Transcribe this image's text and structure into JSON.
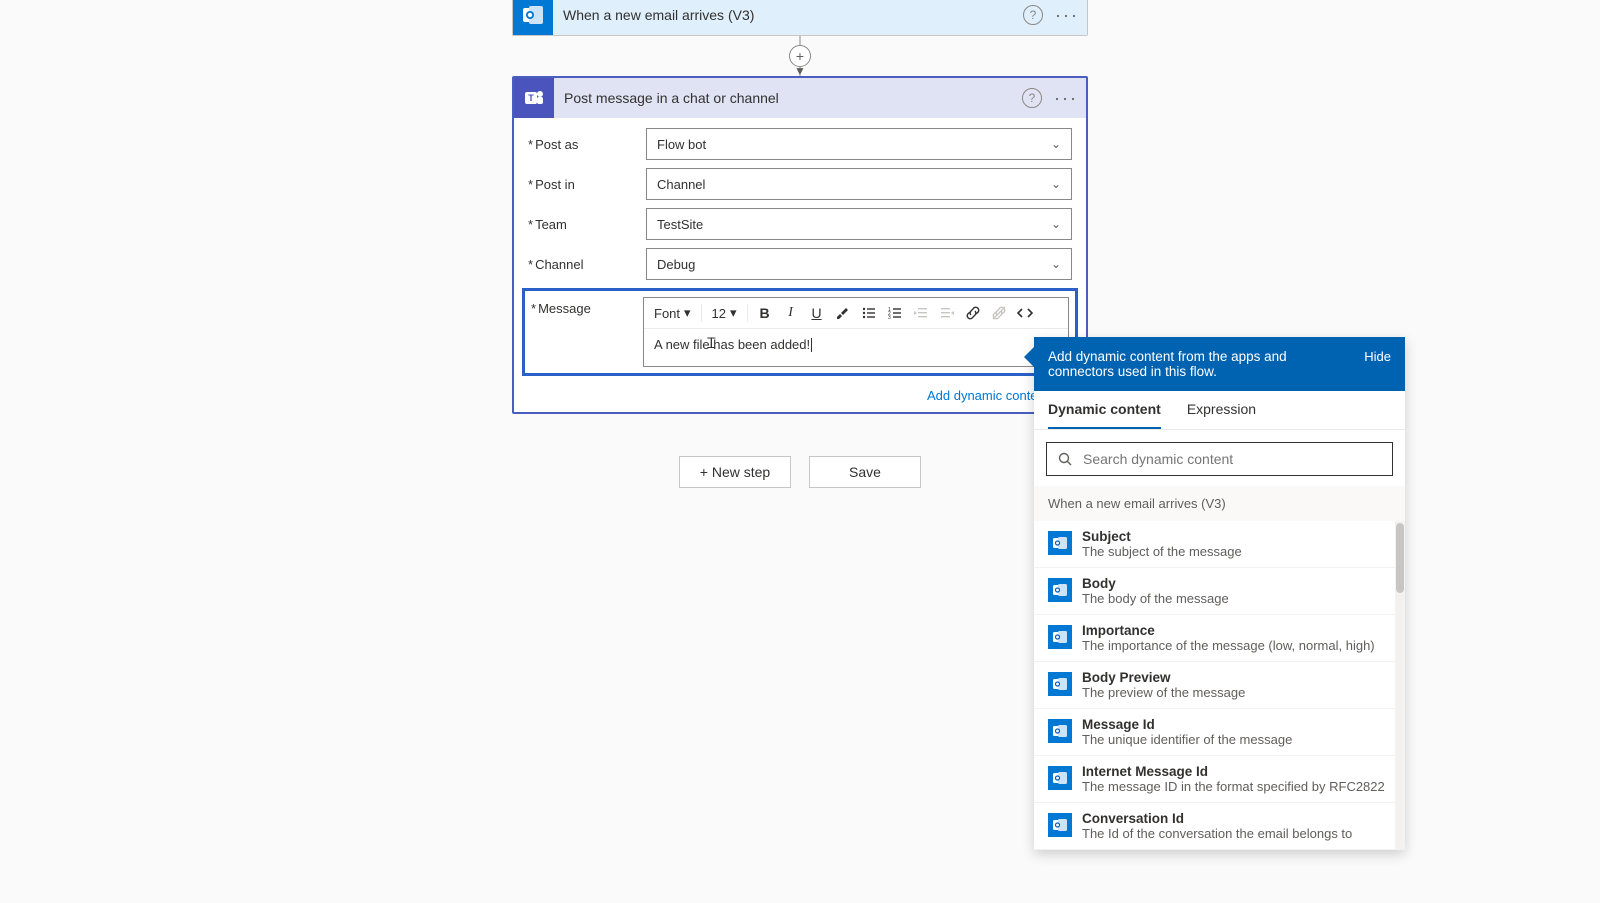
{
  "trigger": {
    "title": "When a new email arrives (V3)"
  },
  "action": {
    "title": "Post message in a chat or channel",
    "fields": {
      "post_as": {
        "label": "Post as",
        "value": "Flow bot"
      },
      "post_in": {
        "label": "Post in",
        "value": "Channel"
      },
      "team": {
        "label": "Team",
        "value": "TestSite"
      },
      "channel": {
        "label": "Channel",
        "value": "Debug"
      },
      "message": {
        "label": "Message",
        "value": "A new file has been added!"
      }
    },
    "editor_toolbar": {
      "font_label": "Font",
      "font_size": "12"
    },
    "add_dynamic_link": "Add dynamic content"
  },
  "buttons": {
    "new_step": "+ New step",
    "save": "Save"
  },
  "dynamic_panel": {
    "header_text": "Add dynamic content from the apps and connectors used in this flow.",
    "hide": "Hide",
    "tabs": {
      "dynamic": "Dynamic content",
      "expression": "Expression"
    },
    "search_placeholder": "Search dynamic content",
    "group_title": "When a new email arrives (V3)",
    "items": [
      {
        "title": "Subject",
        "desc": "The subject of the message"
      },
      {
        "title": "Body",
        "desc": "The body of the message"
      },
      {
        "title": "Importance",
        "desc": "The importance of the message (low, normal, high)"
      },
      {
        "title": "Body Preview",
        "desc": "The preview of the message"
      },
      {
        "title": "Message Id",
        "desc": "The unique identifier of the message"
      },
      {
        "title": "Internet Message Id",
        "desc": "The message ID in the format specified by RFC2822"
      },
      {
        "title": "Conversation Id",
        "desc": "The Id of the conversation the email belongs to"
      }
    ]
  }
}
